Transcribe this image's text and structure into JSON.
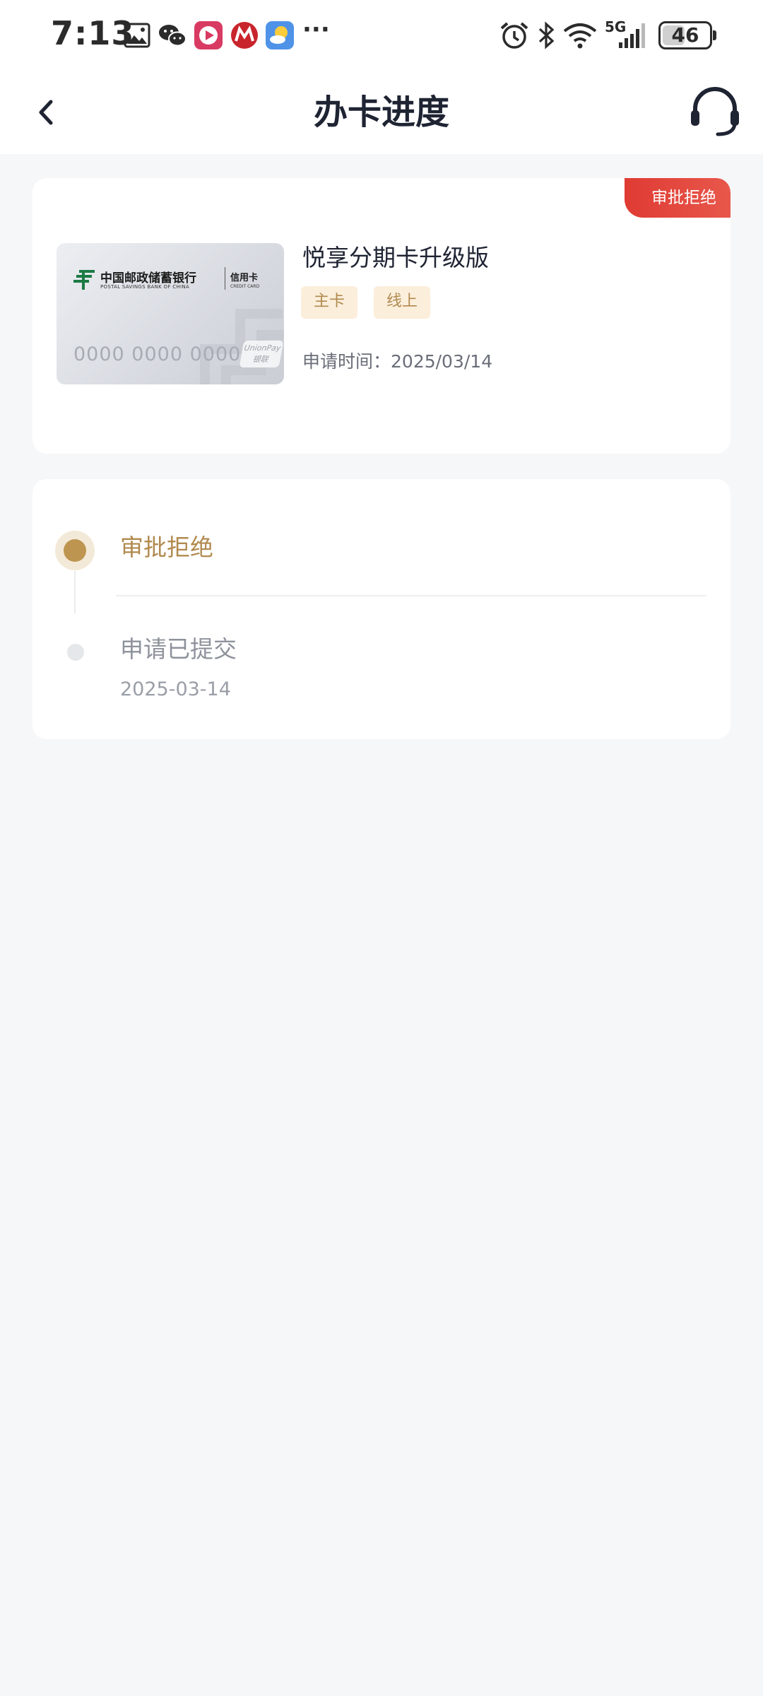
{
  "status_bar": {
    "time": "7:13",
    "signal": "5G",
    "battery": "46",
    "icons": [
      "gallery-icon",
      "wechat-icon",
      "video-app-icon",
      "merchants-app-icon",
      "weather-app-icon",
      "more-notifications-icon",
      "alarm-icon",
      "bluetooth-icon",
      "wifi-icon",
      "cellular-signal-icon",
      "battery-icon"
    ],
    "more": "···"
  },
  "nav": {
    "title": "办卡进度",
    "back_icon": "chevron-left-icon",
    "service_icon": "headset-icon"
  },
  "application": {
    "status_badge": "审批拒绝",
    "card_image": {
      "bank_name_cn": "中国邮政储蓄银行",
      "bank_name_en": "POSTAL SAVINGS BANK OF CHINA",
      "card_type_cn": "信用卡",
      "card_type_en": "CREDIT CARD",
      "card_number": "0000 0000 0000",
      "network_logo": "UnionPay 银联"
    },
    "card_name": "悦享分期卡升级版",
    "tags": [
      "主卡",
      "线上"
    ],
    "apply_time_label": "申请时间：",
    "apply_time": "2025/03/14"
  },
  "progress": {
    "steps": [
      {
        "label": "审批拒绝",
        "date": "",
        "active": true
      },
      {
        "label": "申请已提交",
        "date": "2025-03-14",
        "active": false
      }
    ]
  },
  "colors": {
    "accent_gold": "#b18a4f",
    "reject_red": "#df3b33",
    "tag_bg": "#fbeedb",
    "page_bg": "#f6f7f9"
  }
}
